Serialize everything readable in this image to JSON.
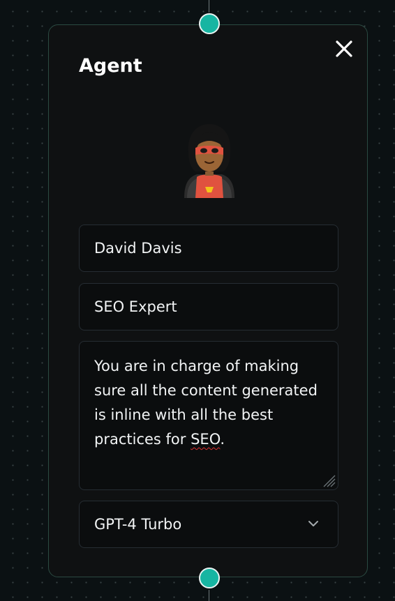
{
  "node": {
    "title": "Agent",
    "avatar_icon": "superhero-icon",
    "name_value": "David Davis",
    "role_value": "SEO Expert",
    "prompt_before": "You are in charge of making sure all the content generated is inline with all the best practices for ",
    "prompt_flagged_word": "SEO",
    "prompt_after": ".",
    "model_selected": "GPT-4 Turbo"
  },
  "colors": {
    "canvas_bg": "#0b1113",
    "card_bg": "#0f1112",
    "card_border": "#2b4a42",
    "handle": "#17b5a2",
    "field_border": "#262d33",
    "spellcheck_underline": "#e03030"
  }
}
